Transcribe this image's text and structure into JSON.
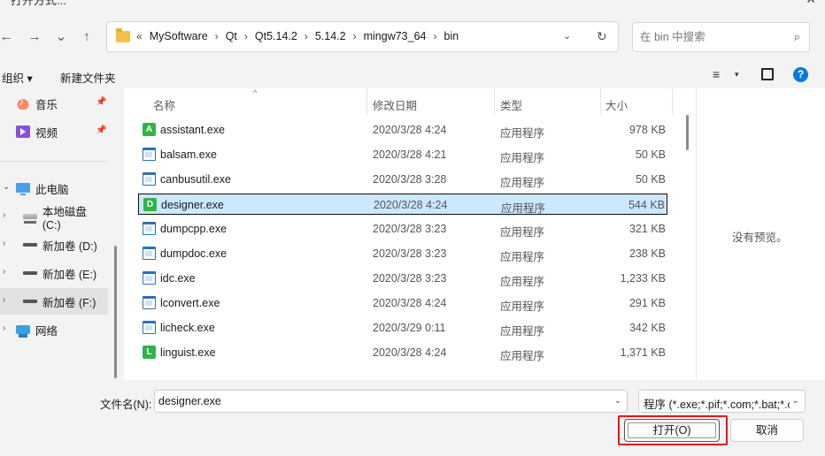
{
  "window": {
    "title": "打开方式...",
    "close_glyph": "✕"
  },
  "nav": {
    "back": "←",
    "forward": "→",
    "recent": "⌄",
    "up": "↑"
  },
  "address": {
    "lead": "«",
    "crumbs": [
      "MySoftware",
      "Qt",
      "Qt5.14.2",
      "5.14.2",
      "mingw73_64",
      "bin"
    ],
    "separator": "›",
    "dropdown": "⌄",
    "refresh": "↻"
  },
  "search": {
    "placeholder": "在 bin 中搜索",
    "icon": "⌕"
  },
  "toolbar": {
    "organize": "组织 ▾",
    "new_folder": "新建文件夹",
    "view": "≡",
    "view_dropdown": "▾",
    "help": "?"
  },
  "sidebar": {
    "items": [
      {
        "label": "音乐",
        "pin": "📌"
      },
      {
        "label": "视频",
        "pin": "📌"
      },
      {
        "label": "此电脑",
        "chevron": "⌄"
      },
      {
        "label": "本地磁盘 (C:)",
        "chevron": "›"
      },
      {
        "label": "新加卷 (D:)",
        "chevron": "›"
      },
      {
        "label": "新加卷 (E:)",
        "chevron": "›"
      },
      {
        "label": "新加卷 (F:)",
        "chevron": "›"
      },
      {
        "label": "网络",
        "chevron": "›"
      }
    ]
  },
  "columns": {
    "name": "名称",
    "date": "修改日期",
    "type": "类型",
    "size": "大小",
    "sort_arrow": "^"
  },
  "files": [
    {
      "name": "assistant.exe",
      "date": "2020/3/28 4:24",
      "type": "应用程序",
      "size": "978 KB",
      "icon": "A"
    },
    {
      "name": "balsam.exe",
      "date": "2020/3/28 4:21",
      "type": "应用程序",
      "size": "50 KB",
      "icon": ""
    },
    {
      "name": "canbusutil.exe",
      "date": "2020/3/28 3:28",
      "type": "应用程序",
      "size": "50 KB",
      "icon": ""
    },
    {
      "name": "designer.exe",
      "date": "2020/3/28 4:24",
      "type": "应用程序",
      "size": "544 KB",
      "icon": "D"
    },
    {
      "name": "dumpcpp.exe",
      "date": "2020/3/28 3:23",
      "type": "应用程序",
      "size": "321 KB",
      "icon": ""
    },
    {
      "name": "dumpdoc.exe",
      "date": "2020/3/28 3:23",
      "type": "应用程序",
      "size": "238 KB",
      "icon": ""
    },
    {
      "name": "idc.exe",
      "date": "2020/3/28 3:23",
      "type": "应用程序",
      "size": "1,233 KB",
      "icon": ""
    },
    {
      "name": "lconvert.exe",
      "date": "2020/3/28 4:24",
      "type": "应用程序",
      "size": "291 KB",
      "icon": ""
    },
    {
      "name": "licheck.exe",
      "date": "2020/3/29 0:11",
      "type": "应用程序",
      "size": "342 KB",
      "icon": ""
    },
    {
      "name": "linguist.exe",
      "date": "2020/3/28 4:24",
      "type": "应用程序",
      "size": "1,371 KB",
      "icon": "L"
    }
  ],
  "preview": {
    "message": "没有预览。"
  },
  "bottom": {
    "filename_label": "文件名(N):",
    "filename_value": "designer.exe",
    "filter": "程序 (*.exe;*.pif;*.com;*.bat;*.cmd)",
    "dropdown": "⌄",
    "open_label": "打开(O)",
    "cancel_label": "取消"
  },
  "colors": {
    "selection": "#cce8ff",
    "highlight_box": "#ee1111",
    "accent": "#0a7bd8"
  }
}
